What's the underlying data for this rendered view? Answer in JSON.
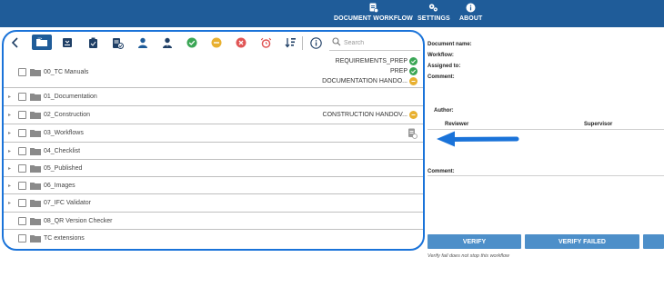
{
  "nav": {
    "document_workflow": "DOCUMENT WORKFLOW",
    "settings": "SETTINGS",
    "about": "ABOUT"
  },
  "toolbar": {
    "icons": [
      "back-icon",
      "folder-view-icon",
      "inbox-download-icon",
      "clipboard-check-icon",
      "document-check-icon",
      "user-icon",
      "user-tie-icon",
      "green-check-status-icon",
      "yellow-pending-status-icon",
      "red-reject-status-icon",
      "alarm-icon",
      "sort-icon",
      "info-icon"
    ],
    "search_placeholder": "Search"
  },
  "tree": {
    "rows": [
      {
        "label": "00_TC Manuals",
        "expandable": false
      },
      {
        "label": "01_Documentation",
        "expandable": true
      },
      {
        "label": "02_Construction",
        "expandable": true
      },
      {
        "label": "03_Workflows",
        "expandable": true
      },
      {
        "label": "04_Checklist",
        "expandable": true
      },
      {
        "label": "05_Published",
        "expandable": true
      },
      {
        "label": "06_Images",
        "expandable": true
      },
      {
        "label": "07_IFC Validator",
        "expandable": true
      },
      {
        "label": "08_QR Version Checker",
        "expandable": false
      },
      {
        "label": "TC extensions",
        "expandable": false
      }
    ],
    "badges": {
      "r0_a": "REQUIREMENTS_PREP",
      "r0_b": "PREP",
      "r0_c": "DOCUMENTATION HANDO...",
      "r2_a": "CONSTRUCTION HANDOV..."
    }
  },
  "details": {
    "document_name": "Document name:",
    "workflow": "Workflow:",
    "assigned_to": "Assigned to:",
    "comment": "Comment:",
    "author": "Author:",
    "reviewer": "Reviewer",
    "supervisor": "Supervisor",
    "comment2": "Comment:",
    "verify": "VERIFY",
    "verify_failed": "VERIFY FAILED",
    "note": "Verify fail does not stop this workflow"
  },
  "colors": {
    "topbar": "#1f5c99",
    "highlight_border": "#1a73d9",
    "status_green": "#3aa655",
    "status_yellow": "#e8b030",
    "status_red": "#e05555",
    "arrow": "#1a73d9",
    "button": "#4d8fc9"
  }
}
